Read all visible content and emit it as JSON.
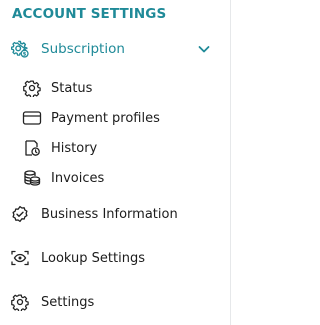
{
  "sidebar": {
    "title": "ACCOUNT SETTINGS",
    "subscription": {
      "label": "Subscription",
      "icon": "subscription-gear-icon",
      "expanded": true,
      "children": [
        {
          "label": "Status",
          "icon": "gear-icon"
        },
        {
          "label": "Payment profiles",
          "icon": "credit-card-icon"
        },
        {
          "label": "History",
          "icon": "history-icon"
        },
        {
          "label": "Invoices",
          "icon": "coins-icon"
        }
      ]
    },
    "items": [
      {
        "label": "Business Information",
        "icon": "badge-check-icon"
      },
      {
        "label": "Lookup Settings",
        "icon": "eye-scan-icon"
      },
      {
        "label": "Settings",
        "icon": "gear-icon"
      }
    ]
  },
  "colors": {
    "accent": "#1f8a98",
    "text": "#1c1c1c",
    "divider": "#e6e8ea"
  }
}
